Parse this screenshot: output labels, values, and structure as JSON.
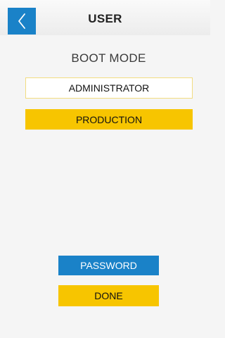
{
  "header": {
    "title": "USER",
    "back_icon": "chevron-left-icon"
  },
  "boot_mode": {
    "title": "BOOT MODE",
    "options": [
      {
        "label": "ADMINISTRATOR",
        "selected": false
      },
      {
        "label": "PRODUCTION",
        "selected": true
      }
    ]
  },
  "actions": {
    "password_label": "PASSWORD",
    "done_label": "DONE"
  },
  "colors": {
    "accent_blue": "#1a82c8",
    "accent_yellow": "#f7c500",
    "background": "#f5f5f5"
  }
}
